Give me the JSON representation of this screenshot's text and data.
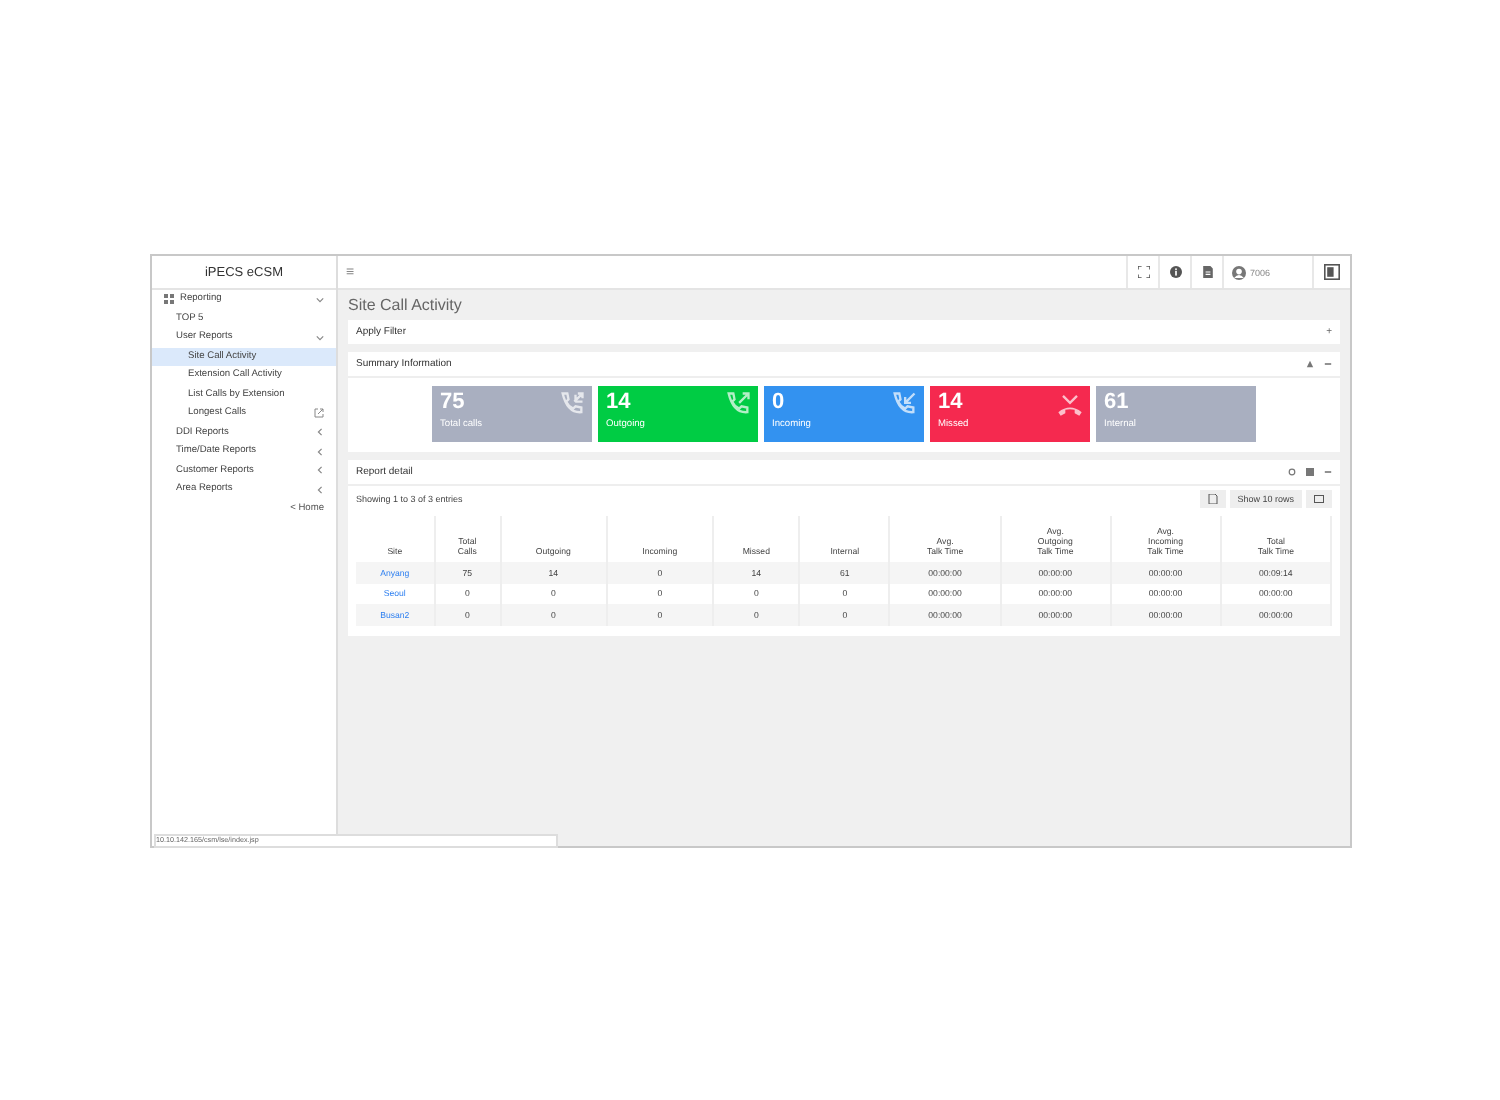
{
  "sidebar": {
    "title": "iPECS eCSM",
    "items": [
      {
        "label": "Reporting",
        "expanded": true,
        "children": [
          {
            "label": "TOP 5",
            "selected": false
          },
          {
            "label": "User Reports",
            "expanded": true,
            "children": [
              {
                "label": "Site Call Activity",
                "selected": true
              },
              {
                "label": "Extension Call Activity",
                "selected": false
              },
              {
                "label": "List Calls by Extension",
                "selected": false
              },
              {
                "label": "Longest Calls",
                "selected": false,
                "external": true
              }
            ]
          },
          {
            "label": "DDI Reports",
            "expanded": false
          },
          {
            "label": "Time/Date Reports",
            "expanded": false
          },
          {
            "label": "Customer Reports",
            "expanded": false
          },
          {
            "label": "Area Reports",
            "expanded": false
          }
        ]
      }
    ],
    "home_link": "< Home"
  },
  "topbar": {
    "menu": "≡",
    "user": "7006"
  },
  "page_title": "Site Call Activity",
  "filter_panel": {
    "title": "Apply Filter",
    "toggle": "+"
  },
  "summary": {
    "title": "Summary Information",
    "cards": [
      {
        "kind": "total",
        "value": "75",
        "label": "Total calls",
        "color": "#a9afc0"
      },
      {
        "kind": "outgoing",
        "value": "14",
        "label": "Outgoing",
        "color": "#00cc44"
      },
      {
        "kind": "incoming",
        "value": "0",
        "label": "Incoming",
        "color": "#3392f0"
      },
      {
        "kind": "missed",
        "value": "14",
        "label": "Missed",
        "color": "#f5294f"
      },
      {
        "kind": "internal",
        "value": "61",
        "label": "Internal",
        "color": "#a9afc0"
      }
    ]
  },
  "report": {
    "title": "Report detail",
    "entries": "Showing 1 to 3 of 3 entries",
    "rows_button": "Show 10 rows",
    "columns": [
      "Site",
      "Total\nCalls",
      "Outgoing",
      "Incoming",
      "Missed",
      "Internal",
      "Avg.\nTalk Time",
      "Avg.\nOutgoing\nTalk Time",
      "Avg.\nIncoming\nTalk Time",
      "Total\nTalk Time"
    ],
    "rows": [
      [
        "Anyang",
        "75",
        "14",
        "0",
        "14",
        "61",
        "00:00:00",
        "00:00:00",
        "00:00:00",
        "00:09:14"
      ],
      [
        "Seoul",
        "0",
        "0",
        "0",
        "0",
        "0",
        "00:00:00",
        "00:00:00",
        "00:00:00",
        "00:00:00"
      ],
      [
        "Busan2",
        "0",
        "0",
        "0",
        "0",
        "0",
        "00:00:00",
        "00:00:00",
        "00:00:00",
        "00:00:00"
      ]
    ]
  },
  "status_bar": "10.10.142.165/csm/lse/index.jsp"
}
